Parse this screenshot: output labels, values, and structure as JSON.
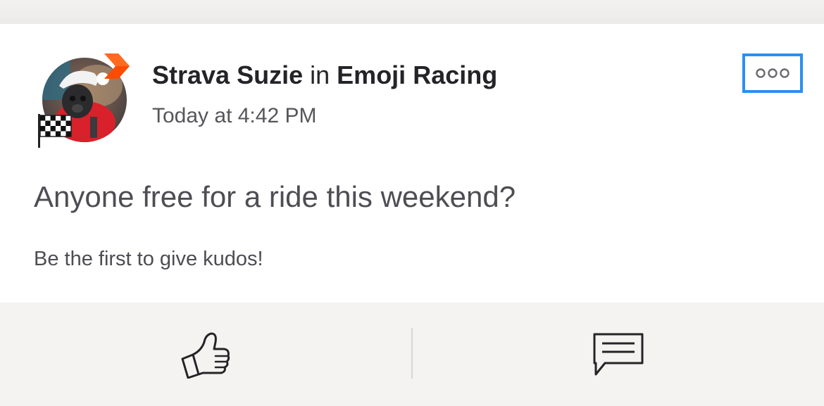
{
  "post": {
    "author": "Strava Suzie",
    "connector": "in",
    "club": "Emoji Racing",
    "timestamp": "Today at 4:42 PM",
    "title": "Anyone free for a ride this weekend?",
    "kudos_prompt": "Be the first to give kudos!"
  },
  "icons": {
    "more": "more-options-icon",
    "kudos": "thumbs-up-icon",
    "comment": "comment-icon",
    "subscriber_badge": "chevron-badge-icon",
    "race_flag": "checkered-flag-icon"
  },
  "colors": {
    "focus_outline": "#2a8ff0",
    "badge_orange": "#fc4c02",
    "text_primary": "#242428",
    "text_secondary": "#4d4d53"
  }
}
